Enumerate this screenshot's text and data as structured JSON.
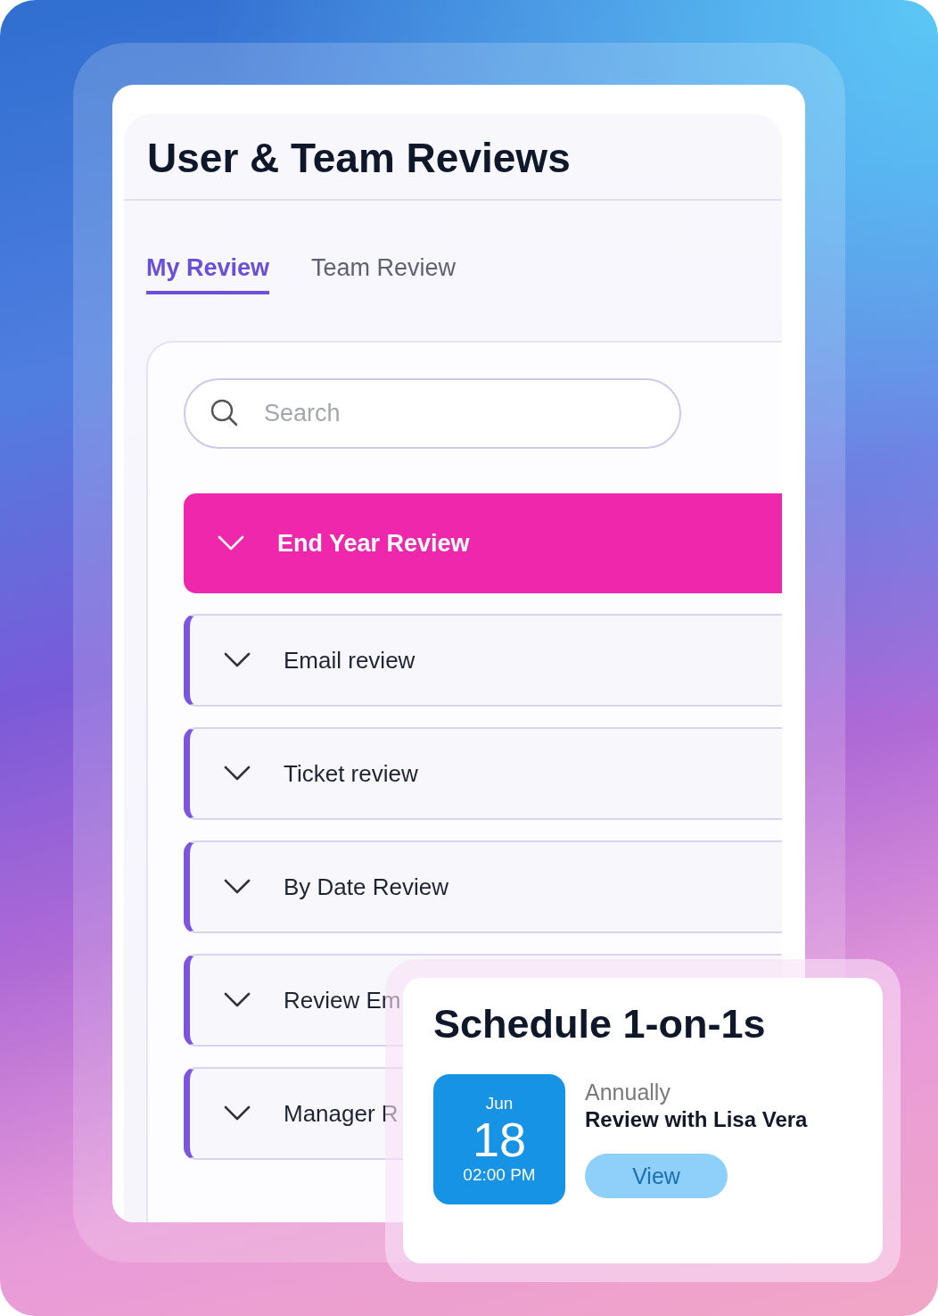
{
  "title": "User & Team Reviews",
  "tabs": [
    {
      "label": "My Review",
      "selected": true
    },
    {
      "label": "Team Review",
      "selected": false
    }
  ],
  "search": {
    "placeholder": "Search"
  },
  "reviews": [
    {
      "label": "End Year Review",
      "selected": true
    },
    {
      "label": "Email review",
      "selected": false
    },
    {
      "label": "Ticket review",
      "selected": false
    },
    {
      "label": "By Date Review",
      "selected": false
    },
    {
      "label": "Review Em",
      "selected": false
    },
    {
      "label": "Manager R",
      "selected": false
    }
  ],
  "schedule": {
    "title": "Schedule 1-on-1s",
    "month": "Jun",
    "day": "18",
    "time": "02:00 PM",
    "frequency": "Annually",
    "subject": "Review with Lisa Vera",
    "button": "View"
  }
}
